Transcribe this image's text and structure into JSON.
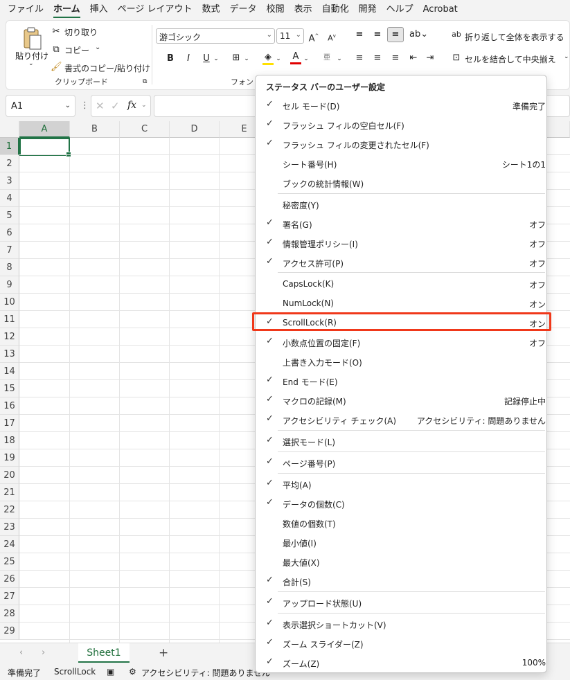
{
  "menubar": {
    "tabs": [
      "ファイル",
      "ホーム",
      "挿入",
      "ページ レイアウト",
      "数式",
      "データ",
      "校閲",
      "表示",
      "自動化",
      "開発",
      "ヘルプ",
      "Acrobat"
    ],
    "active": "ホーム"
  },
  "ribbon": {
    "clipboard": {
      "paste": "貼り付け",
      "cut": "切り取り",
      "copy": "コピー",
      "format_painter": "書式のコピー/貼り付け",
      "label": "クリップボード"
    },
    "font": {
      "name": "游ゴシック",
      "size": "11",
      "label": "フォント",
      "bold": "B",
      "italic": "I",
      "underline": "U"
    },
    "alignment": {
      "wrap": "折り返して全体を表示する",
      "merge": "セルを結合して中央揃え"
    }
  },
  "formula_bar": {
    "name_box": "A1",
    "fx": "fx"
  },
  "grid": {
    "columns": [
      "A",
      "B",
      "C",
      "D",
      "E"
    ],
    "rows": [
      "1",
      "2",
      "3",
      "4",
      "5",
      "6",
      "7",
      "8",
      "9",
      "10",
      "11",
      "12",
      "13",
      "14",
      "15",
      "16",
      "17",
      "18",
      "19",
      "20",
      "21",
      "22",
      "23",
      "24",
      "25",
      "26",
      "27",
      "28",
      "29"
    ]
  },
  "sheets": {
    "tabs": [
      "Sheet1"
    ],
    "add": "+"
  },
  "status": {
    "ready": "準備完了",
    "scroll_lock": "ScrollLock",
    "accessibility": "アクセシビリティ: 問題ありません"
  },
  "menu": {
    "title": "ステータス バーのユーザー設定",
    "items": [
      {
        "label": "セル モード(D)",
        "value": "準備完了",
        "checked": true
      },
      {
        "label": "フラッシュ フィルの空白セル(F)",
        "value": "",
        "checked": true
      },
      {
        "label": "フラッシュ フィルの変更されたセル(F)",
        "value": "",
        "checked": true
      },
      {
        "label": "シート番号(H)",
        "value": "シート1の1",
        "checked": false
      },
      {
        "label": "ブックの統計情報(W)",
        "value": "",
        "checked": false
      },
      {
        "label": "秘密度(Y)",
        "value": "",
        "checked": false
      },
      {
        "label": "署名(G)",
        "value": "オフ",
        "checked": true
      },
      {
        "label": "情報管理ポリシー(I)",
        "value": "オフ",
        "checked": true
      },
      {
        "label": "アクセス許可(P)",
        "value": "オフ",
        "checked": true
      },
      {
        "label": "CapsLock(K)",
        "value": "オフ",
        "checked": false
      },
      {
        "label": "NumLock(N)",
        "value": "オン",
        "checked": false
      },
      {
        "label": "ScrollLock(R)",
        "value": "オン",
        "checked": true
      },
      {
        "label": "小数点位置の固定(F)",
        "value": "オフ",
        "checked": true
      },
      {
        "label": "上書き入力モード(O)",
        "value": "",
        "checked": false
      },
      {
        "label": "End モード(E)",
        "value": "",
        "checked": true
      },
      {
        "label": "マクロの記録(M)",
        "value": "記録停止中",
        "checked": true
      },
      {
        "label": "アクセシビリティ チェック(A)",
        "value": "アクセシビリティ: 問題ありません",
        "checked": true
      },
      {
        "label": "選択モード(L)",
        "value": "",
        "checked": true
      },
      {
        "label": "ページ番号(P)",
        "value": "",
        "checked": true
      },
      {
        "label": "平均(A)",
        "value": "",
        "checked": true
      },
      {
        "label": "データの個数(C)",
        "value": "",
        "checked": true
      },
      {
        "label": "数値の個数(T)",
        "value": "",
        "checked": false
      },
      {
        "label": "最小値(I)",
        "value": "",
        "checked": false
      },
      {
        "label": "最大値(X)",
        "value": "",
        "checked": false
      },
      {
        "label": "合計(S)",
        "value": "",
        "checked": true
      },
      {
        "label": "アップロード状態(U)",
        "value": "",
        "checked": true
      },
      {
        "label": "表示選択ショートカット(V)",
        "value": "",
        "checked": true
      },
      {
        "label": "ズーム スライダー(Z)",
        "value": "",
        "checked": true
      },
      {
        "label": "ズーム(Z)",
        "value": "100%",
        "checked": true
      }
    ]
  },
  "colors": {
    "accent": "#217346",
    "highlight": "#f0381a"
  }
}
